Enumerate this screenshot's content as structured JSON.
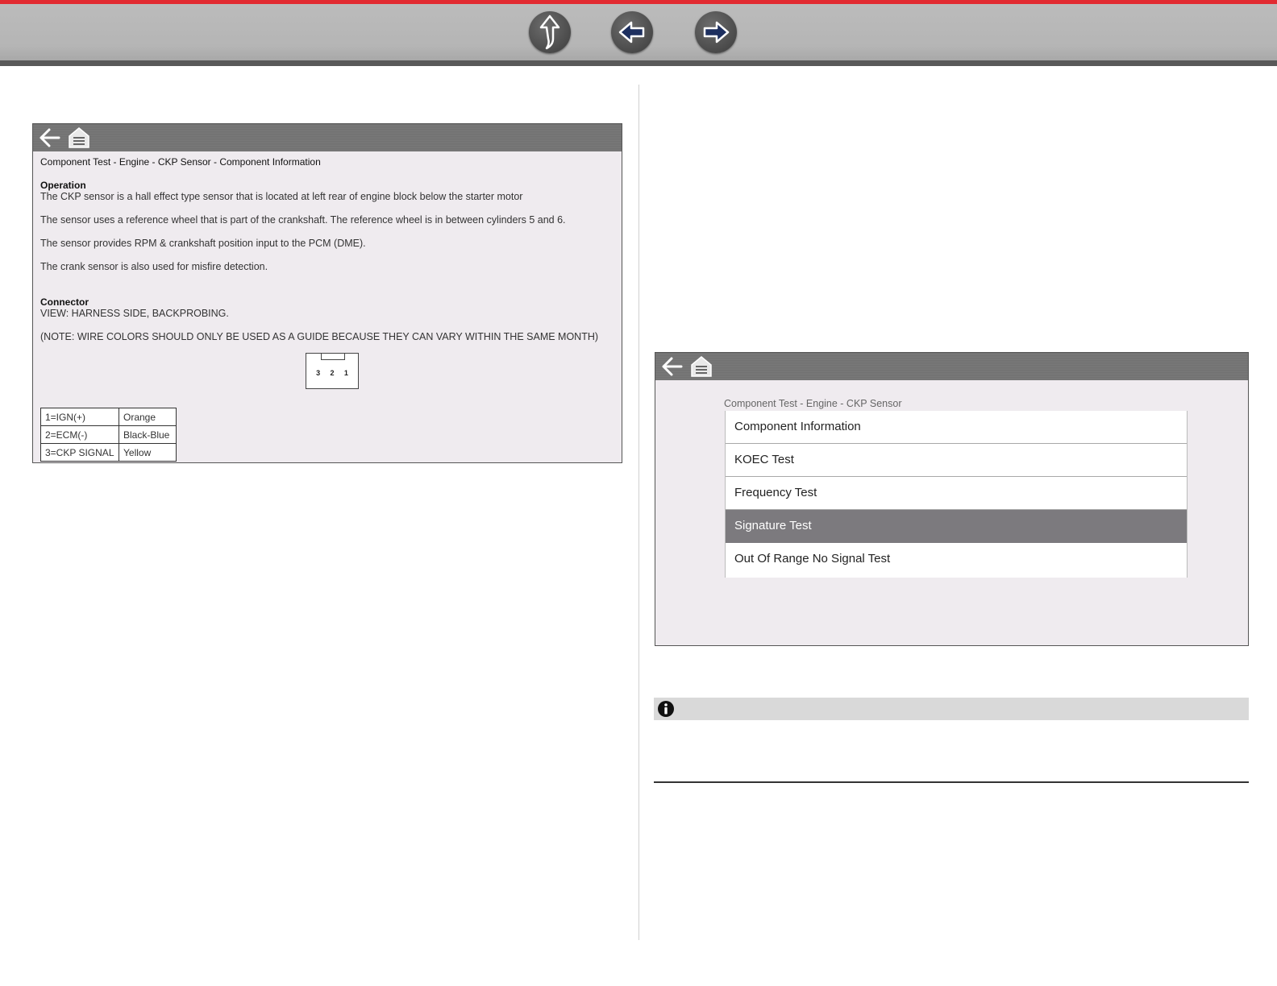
{
  "nav": {
    "up_icon": "up-arrow-icon",
    "back_icon": "left-arrow-icon",
    "forward_icon": "right-arrow-icon",
    "accent_color": "#e22a31"
  },
  "left_screen": {
    "header_icons": [
      "back-arrow-icon",
      "home-garage-icon"
    ],
    "breadcrumb": "Component Test - Engine - CKP Sensor - Component Information",
    "operation_title": "Operation",
    "operation_lines": [
      "The CKP sensor is a hall effect type sensor that is located at left rear of engine block below the starter motor",
      "The sensor uses a reference wheel that is part of the crankshaft. The reference wheel is in between cylinders 5 and 6.",
      "The sensor provides RPM &  crankshaft position input to the PCM (DME).",
      "The crank sensor is also used for misfire detection."
    ],
    "connector_title": "Connector",
    "connector_view": "VIEW: HARNESS SIDE, BACKPROBING.",
    "connector_note": "(NOTE: WIRE COLORS SHOULD ONLY BE USED AS A GUIDE BECAUSE THEY CAN VARY WITHIN THE SAME MONTH)",
    "connector_pins": [
      "3",
      "2",
      "1"
    ],
    "pin_table": [
      [
        "1=IGN(+)",
        "Orange"
      ],
      [
        "2=ECM(-)",
        "Black-Blue"
      ],
      [
        "3=CKP SIGNAL",
        "Yellow"
      ]
    ]
  },
  "right_screen": {
    "header_icons": [
      "back-arrow-icon",
      "home-garage-icon"
    ],
    "breadcrumb": "Component Test - Engine - CKP Sensor",
    "menu_items": [
      {
        "label": "Component Information",
        "selected": false
      },
      {
        "label": "KOEC Test",
        "selected": false
      },
      {
        "label": "Frequency Test",
        "selected": false
      },
      {
        "label": "Signature Test",
        "selected": true
      },
      {
        "label": "Out Of Range No Signal Test",
        "selected": false
      }
    ]
  },
  "note": {
    "icon": "info-icon"
  }
}
